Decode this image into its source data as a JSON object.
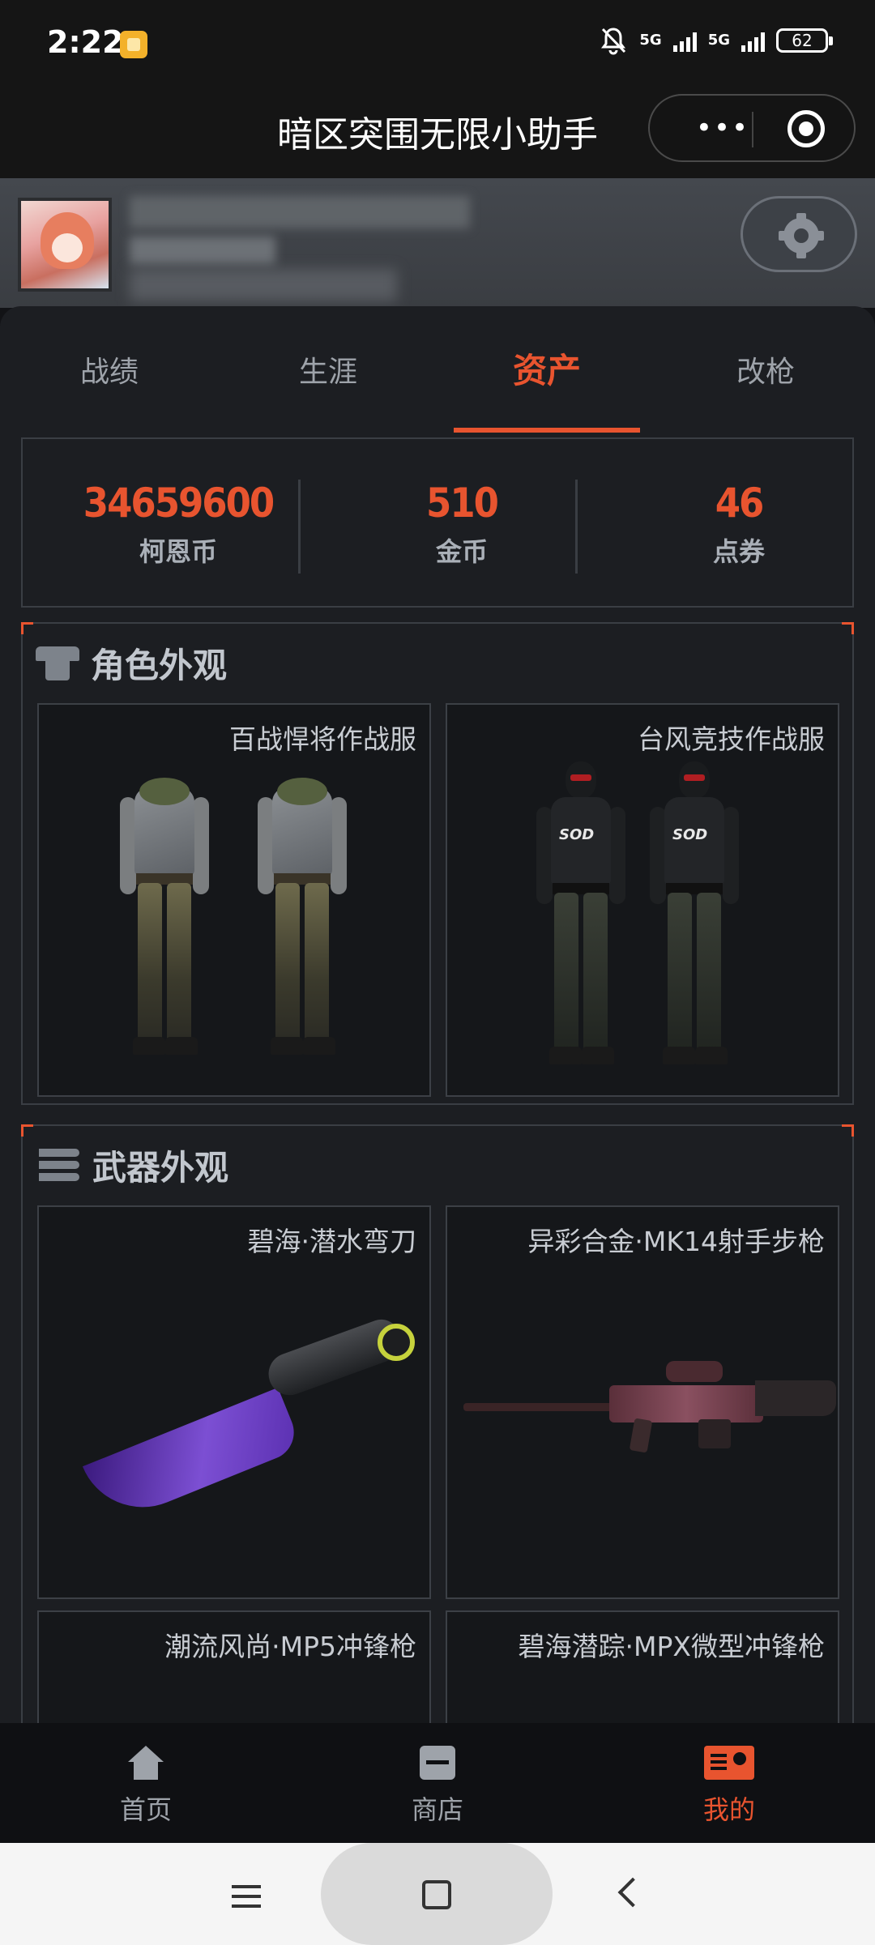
{
  "status_bar": {
    "time": "2:22",
    "network1": "5G",
    "network2": "5G",
    "battery": "62"
  },
  "title_bar": {
    "title": "暗区突围无限小助手",
    "more_label": "•••"
  },
  "tabs": [
    {
      "label": "战绩"
    },
    {
      "label": "生涯"
    },
    {
      "label": "资产"
    },
    {
      "label": "改枪"
    }
  ],
  "stats": [
    {
      "value": "34659600",
      "label": "柯恩币"
    },
    {
      "value": "510",
      "label": "金币"
    },
    {
      "value": "46",
      "label": "点券"
    }
  ],
  "sections": {
    "outfit": {
      "title": "角色外观",
      "items": [
        {
          "name": "百战悍将作战服"
        },
        {
          "name": "台风竞技作战服"
        }
      ]
    },
    "weapons": {
      "title": "武器外观",
      "items": [
        {
          "name": "碧海·潜水弯刀"
        },
        {
          "name": "异彩合金·MK14射手步枪"
        },
        {
          "name": "潮流风尚·MP5冲锋枪"
        },
        {
          "name": "碧海潜踪·MPX微型冲锋枪"
        }
      ]
    }
  },
  "bottom_nav": [
    {
      "label": "首页",
      "icon": "home-icon"
    },
    {
      "label": "商店",
      "icon": "shop-icon"
    },
    {
      "label": "我的",
      "icon": "profile-card-icon"
    }
  ],
  "colors": {
    "accent": "#e8542f",
    "background": "#1c1e22"
  }
}
